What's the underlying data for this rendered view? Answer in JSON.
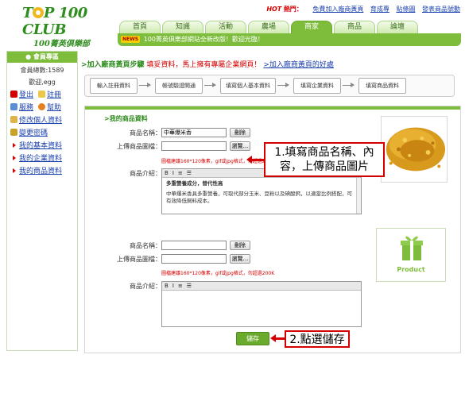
{
  "header": {
    "logo_line1": "T P 100 CLUB",
    "logo_line2": "100菁英俱樂部",
    "hot_prefix": "HOT",
    "hot_label": "熱門：",
    "hot_links": [
      "免費加入廠商黃頁",
      "育成專",
      "贴條圖",
      "發表商品號動"
    ],
    "tabs": [
      "首頁",
      "知識",
      "活動",
      "農場",
      "商家",
      "商品",
      "論壇"
    ],
    "active_tab": 4,
    "news_badge": "NEWS",
    "news_text": "100菁英俱樂部網站全新改版！歡迎光臨！"
  },
  "sidebar": {
    "title": "會員專區",
    "member_count": "會員總數:1589",
    "welcome": "歡迎,egg",
    "row1": [
      {
        "label": "登出",
        "icon": "logout-icon"
      },
      {
        "label": "註冊",
        "icon": "register-icon"
      }
    ],
    "row2": [
      {
        "label": "服務",
        "icon": "service-icon"
      },
      {
        "label": "幫助",
        "icon": "help-icon"
      }
    ],
    "links": [
      {
        "label": "修改個人資料",
        "icon": "edit-profile-icon"
      },
      {
        "label": "變更密碼",
        "icon": "lock-icon"
      }
    ],
    "sub_links": [
      "我的基本資料",
      "我的企業資料",
      "我的商品資料"
    ]
  },
  "steps": {
    "title": ">加入廠商黃頁步驟",
    "red_note": "填妥資料，馬上擁有專屬企業網頁！",
    "link": ">加入廠商黃頁的好處",
    "items": [
      "輸入註冊資料",
      "帳號驗證開通",
      "填寫個人基本資料",
      "填寫企業資料",
      "填寫商品資料"
    ]
  },
  "form": {
    "section_title": ">我的商品資料",
    "name_label": "商品名稱：",
    "image_label": "上傳商品圖檔：",
    "desc_label": "商品介紹：",
    "delete_label": "刪除",
    "browse_label": "瀏覽...",
    "hint": "圖檔建議160*120像素，gif或jpg格式，勿超過200K",
    "product1": {
      "name": "中華爆米香",
      "desc_title": "多重營養成分，替代性高",
      "desc_body": "中華爆米香具多重營養，可取代部分玉米、豆粉以及碘酸鈣，以適當比例搭配，可有效降低飼料成本。"
    },
    "product2": {
      "name": "",
      "placeholder_label": "Product"
    },
    "editor_tools": [
      "B",
      "I",
      "≡",
      "☰"
    ],
    "save_label": "儲存"
  },
  "callouts": {
    "c1_line1": "1.填寫商品名稱、內",
    "c1_line2": "容，上傳商品圖片",
    "c2": "2.點選儲存"
  }
}
